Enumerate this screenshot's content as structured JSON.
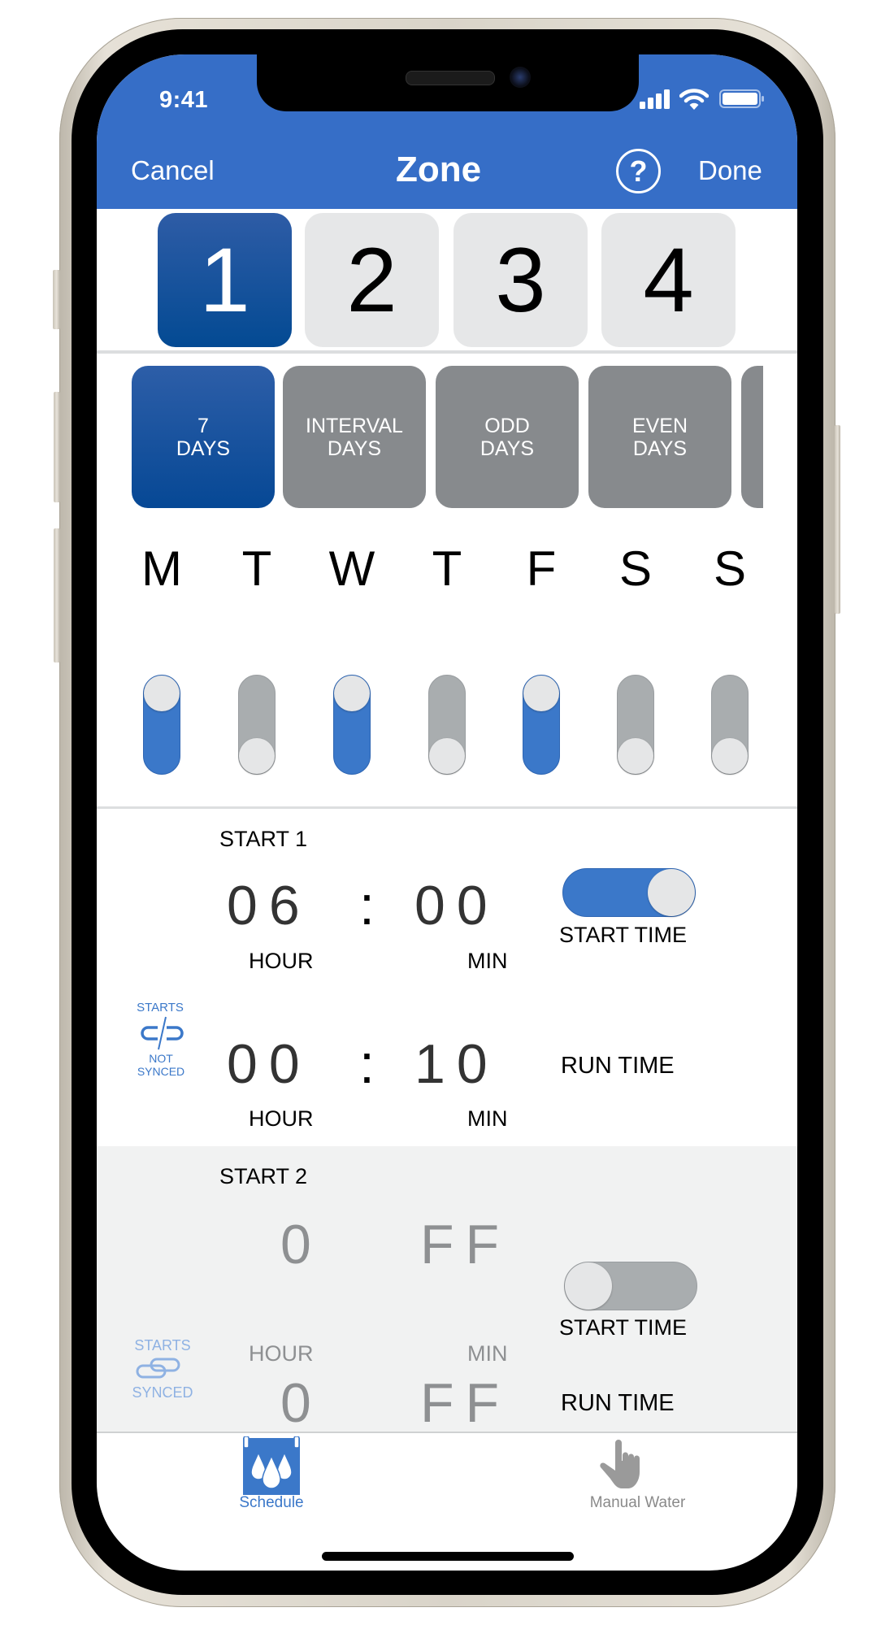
{
  "status_bar": {
    "time": "9:41",
    "icons": [
      "cellular-signal-icon",
      "wifi-icon",
      "battery-icon"
    ]
  },
  "nav": {
    "cancel_label": "Cancel",
    "title": "Zone",
    "help_icon": "question-circle-icon",
    "help_glyph": "?",
    "done_label": "Done"
  },
  "zones": {
    "items": [
      {
        "label": "1",
        "selected": true
      },
      {
        "label": "2",
        "selected": false
      },
      {
        "label": "3",
        "selected": false
      },
      {
        "label": "4",
        "selected": false
      }
    ]
  },
  "day_types": {
    "items": [
      {
        "line1": "7",
        "line2": "DAYS",
        "selected": true
      },
      {
        "line1": "INTERVAL",
        "line2": "DAYS",
        "selected": false
      },
      {
        "line1": "ODD",
        "line2": "DAYS",
        "selected": false
      },
      {
        "line1": "EVEN",
        "line2": "DAYS",
        "selected": false
      }
    ]
  },
  "weekdays": {
    "items": [
      {
        "letter": "M",
        "enabled": true
      },
      {
        "letter": "T",
        "enabled": false
      },
      {
        "letter": "W",
        "enabled": true
      },
      {
        "letter": "T",
        "enabled": false
      },
      {
        "letter": "F",
        "enabled": true
      },
      {
        "letter": "S",
        "enabled": false
      },
      {
        "letter": "S",
        "enabled": false
      }
    ]
  },
  "starts": [
    {
      "title": "START 1",
      "sync_top": "STARTS",
      "sync_bottom": "NOT SYNCED",
      "sync_icon": "link-broken-icon",
      "start_hour": "06",
      "start_min": "00",
      "separator": ":",
      "hour_label": "HOUR",
      "min_label": "MIN",
      "start_time_label": "START TIME",
      "start_time_enabled": true,
      "run_hour": "00",
      "run_min": "10",
      "run_time_label": "RUN TIME"
    },
    {
      "title": "START 2",
      "sync_top": "STARTS",
      "sync_bottom": "SYNCED",
      "sync_icon": "link-icon",
      "start_hour": "0",
      "start_min": "FF",
      "hour_label": "HOUR",
      "min_label": "MIN",
      "start_time_label": "START TIME",
      "start_time_enabled": false,
      "run_hour": "0",
      "run_min": "FF",
      "run_time_label": "RUN TIME"
    }
  ],
  "tabbar": {
    "items": [
      {
        "label": "Schedule",
        "icon": "water-drops-calendar-icon",
        "active": true
      },
      {
        "label": "Manual Water",
        "icon": "hand-pointer-icon",
        "active": false
      }
    ]
  },
  "colors": {
    "brand_blue": "#366ec7",
    "selected_dark_blue": "#064895",
    "toggle_on": "#3b78c9",
    "toggle_off": "#a9adaf",
    "inactive_button": "#878a8d"
  }
}
